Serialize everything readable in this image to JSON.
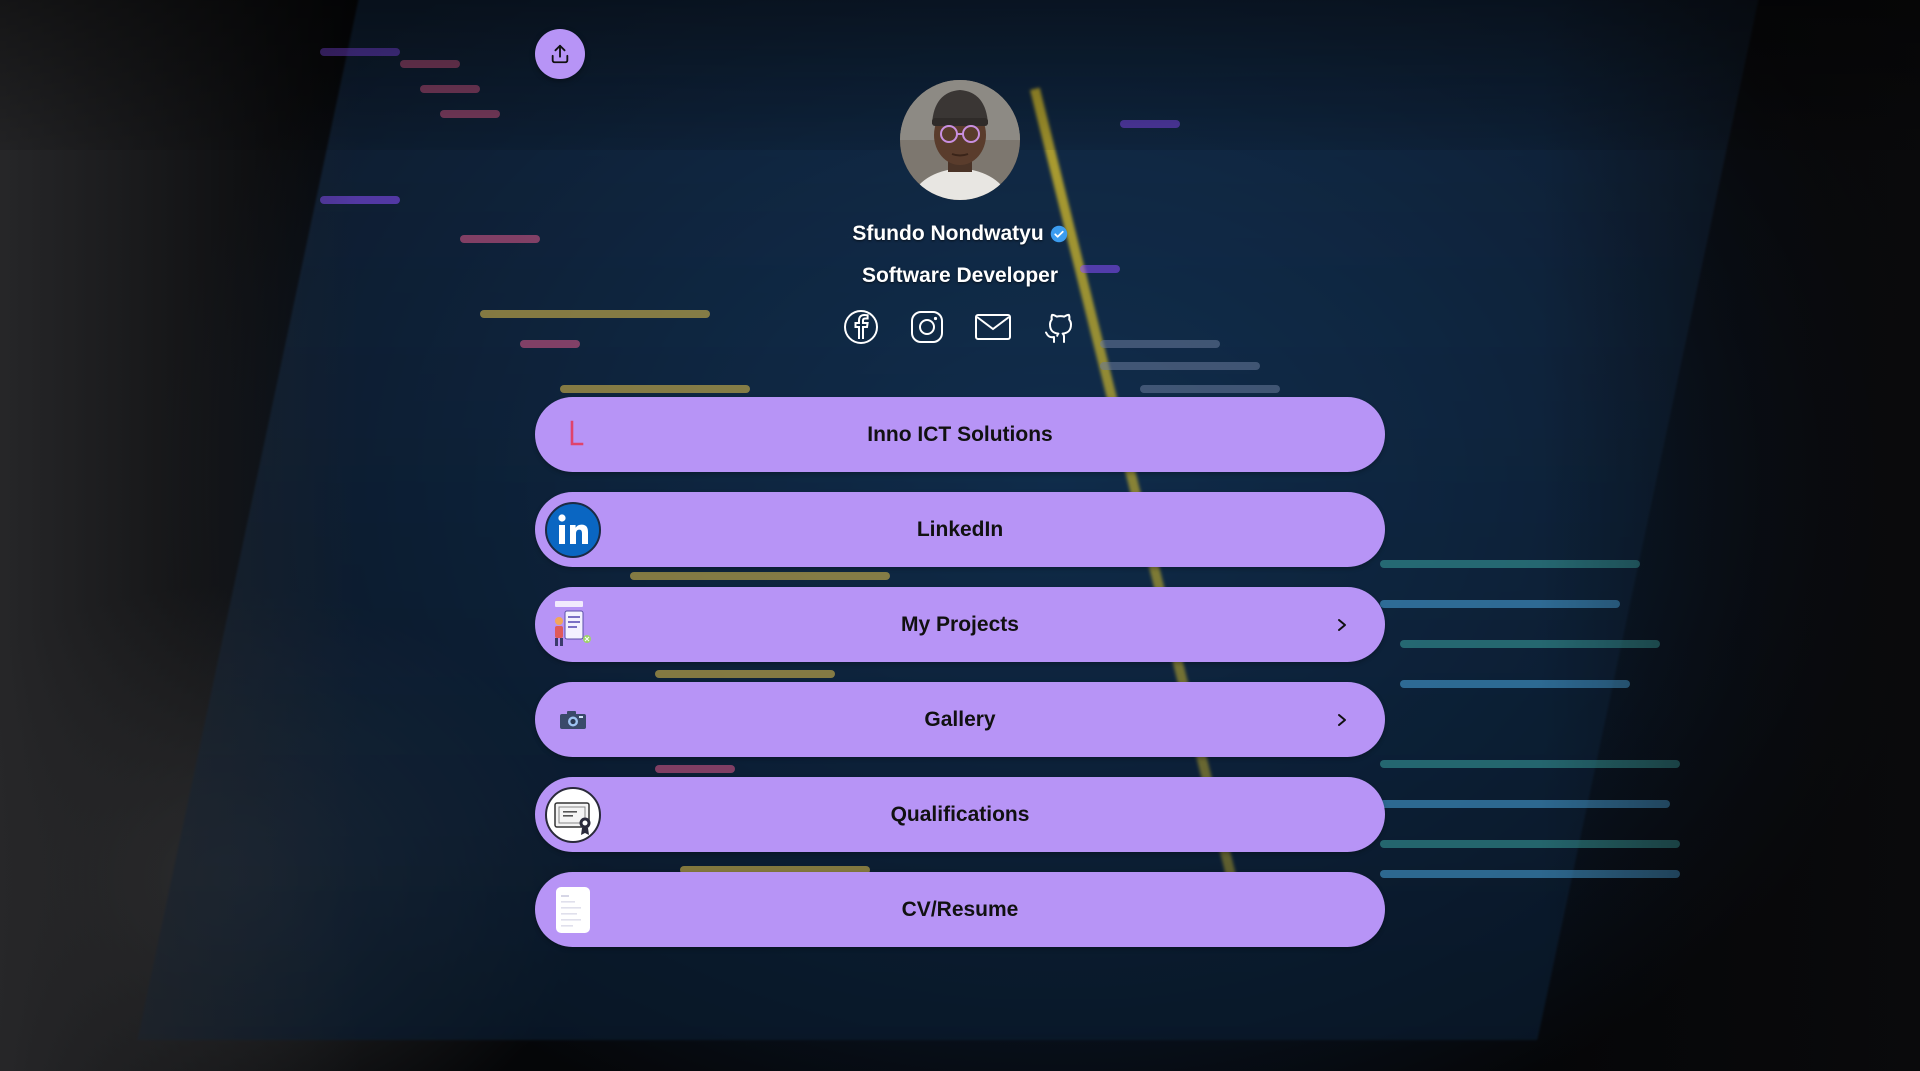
{
  "profile": {
    "name": "Sfundo Nondwatyu",
    "title": "Software Developer",
    "verified": true
  },
  "share": {
    "icon": "share-upload-icon"
  },
  "socials": [
    {
      "name": "Facebook",
      "icon": "facebook-icon"
    },
    {
      "name": "Instagram",
      "icon": "instagram-icon"
    },
    {
      "name": "Email",
      "icon": "mail-icon"
    },
    {
      "name": "GitHub",
      "icon": "github-icon"
    }
  ],
  "links": [
    {
      "label": "Inno ICT Solutions",
      "icon": "inno-logo-icon",
      "has_chevron": false
    },
    {
      "label": "LinkedIn",
      "icon": "linkedin-icon",
      "has_chevron": false
    },
    {
      "label": "My Projects",
      "icon": "projects-icon",
      "has_chevron": true
    },
    {
      "label": "Gallery",
      "icon": "camera-icon",
      "has_chevron": true
    },
    {
      "label": "Qualifications",
      "icon": "certificate-icon",
      "has_chevron": false
    },
    {
      "label": "CV/Resume",
      "icon": "document-icon",
      "has_chevron": false
    }
  ],
  "colors": {
    "button_bg": "#b794f6",
    "button_text": "#111111",
    "text_light": "#ffffff",
    "verified_blue": "#3b9cf0",
    "linkedin_blue": "#0a66c2",
    "inno_red": "#e0436b"
  }
}
